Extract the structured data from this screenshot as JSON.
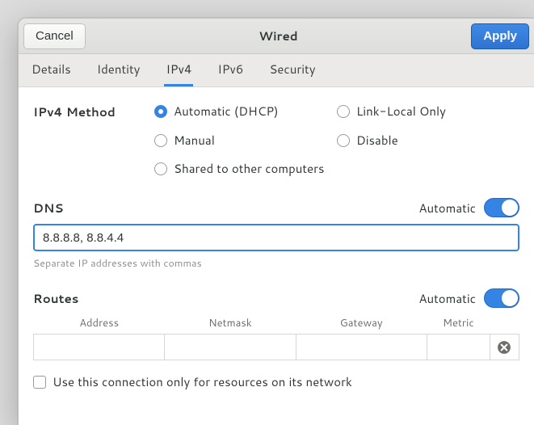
{
  "buttons": {
    "cancel": "Cancel",
    "apply": "Apply"
  },
  "title": "Wired",
  "tabs": {
    "details": "Details",
    "identity": "Identity",
    "ipv4": "IPv4",
    "ipv6": "IPv6",
    "security": "Security",
    "active": "ipv4"
  },
  "ipv4": {
    "method_label": "IPv4 Method",
    "methods": {
      "auto": "Automatic (DHCP)",
      "link_local": "Link-Local Only",
      "manual": "Manual",
      "disable": "Disable",
      "shared": "Shared to other computers",
      "selected": "auto"
    },
    "dns": {
      "label": "DNS",
      "automatic_label": "Automatic",
      "automatic_on": true,
      "value": "8.8.8.8, 8.8.4.4",
      "help": "Separate IP addresses with commas"
    },
    "routes": {
      "label": "Routes",
      "automatic_label": "Automatic",
      "automatic_on": true,
      "headers": {
        "address": "Address",
        "netmask": "Netmask",
        "gateway": "Gateway",
        "metric": "Metric"
      },
      "row": {
        "address": "",
        "netmask": "",
        "gateway": "",
        "metric": ""
      }
    },
    "only_resources_label": "Use this connection only for resources on its network",
    "only_resources_checked": false
  }
}
